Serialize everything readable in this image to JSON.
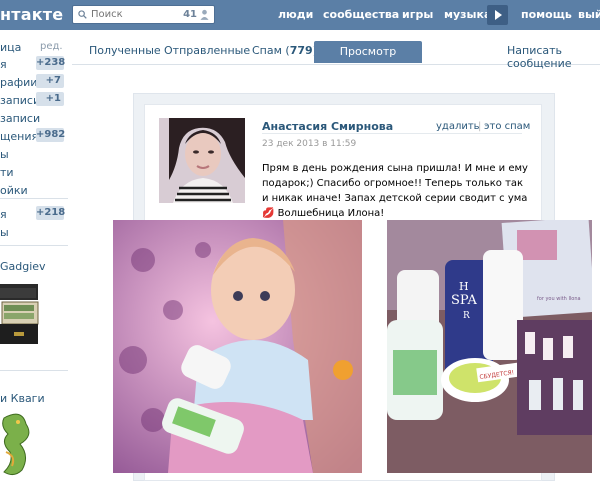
{
  "header": {
    "logo": "нтакте",
    "search_placeholder": "Поиск",
    "search_count": "41",
    "nav": [
      "люди",
      "сообщества",
      "игры",
      "музыка",
      "помощь",
      "вый"
    ]
  },
  "sidebar": {
    "items": [
      {
        "label": "ица",
        "edit": "ред."
      },
      {
        "label": "я",
        "badge": "+238"
      },
      {
        "label": "рафии",
        "badge": "+7"
      },
      {
        "label": "записи",
        "badge": "+1"
      },
      {
        "label": "записи"
      },
      {
        "label": "щения",
        "badge": "+982"
      },
      {
        "label": "ы"
      },
      {
        "label": "ти"
      },
      {
        "label": "ойки"
      },
      {
        "label": "я",
        "badge": "+218"
      },
      {
        "label": "ы"
      }
    ],
    "ad1_title": "Gadgiev",
    "ad2_title": "и Кваги"
  },
  "tabs": {
    "received": "Полученные",
    "sent": "Отправленные",
    "spam_label": "Спам",
    "spam_open": "(",
    "spam_count": "779",
    "spam_close": ")",
    "view": "Просмотр сообщения",
    "write": "Написать сообщение"
  },
  "message": {
    "author": "Анастасия Смирнова",
    "date": "23 дек 2013 в 11:59",
    "delete": "удалить",
    "separator": "|",
    "spam": "это спам",
    "text": "Прям в день рождения сына пришла! И мне и ему подарок;) Спасибо огромное!! Теперь только так и никак иначе! Запах детской серии сводит с ума 💋 Волшебница Илона!"
  },
  "products": {
    "brand_line1": "H",
    "brand_line2": "SPA",
    "brand_line3": "R",
    "sticker": "СБУДЕТСЯ!",
    "box_label": "for you with Ilona"
  },
  "colors": {
    "header_bg": "#5b7fa6",
    "link": "#2b587a",
    "badge_bg": "#d6e0ea"
  }
}
